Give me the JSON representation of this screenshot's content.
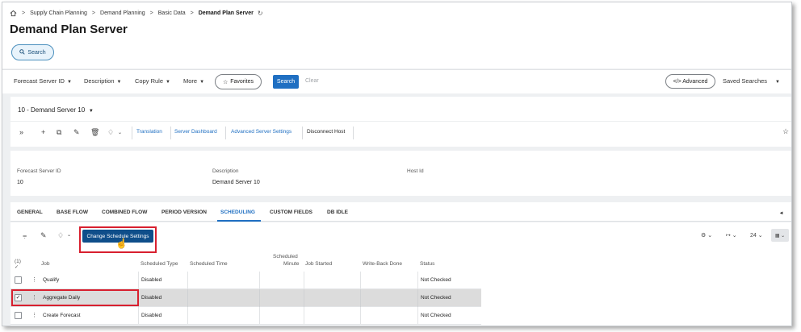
{
  "breadcrumb": {
    "items": [
      "Supply Chain Planning",
      "Demand Planning",
      "Basic Data"
    ],
    "current": "Demand Plan Server"
  },
  "page_title": "Demand Plan Server",
  "search_button": "Search",
  "filters": {
    "forecast_server_id": "Forecast Server ID",
    "description": "Description",
    "copy_rule": "Copy Rule",
    "more": "More",
    "favorites": "Favorites",
    "search": "Search",
    "clear": "Clear",
    "advanced": "</> Advanced",
    "saved_searches": "Saved Searches"
  },
  "server_selector": "10 - Demand Server 10",
  "toolbar": {
    "translation": "Translation",
    "server_dashboard": "Server Dashboard",
    "advanced_server_settings": "Advanced Server Settings",
    "disconnect_host": "Disconnect Host"
  },
  "info": {
    "forecast_server_id_label": "Forecast Server ID",
    "forecast_server_id_value": "10",
    "description_label": "Description",
    "description_value": "Demand Server 10",
    "host_id_label": "Host Id",
    "host_id_value": ""
  },
  "tabs": [
    "GENERAL",
    "BASE FLOW",
    "COMBINED FLOW",
    "PERIOD VERSION",
    "SCHEDULING",
    "CUSTOM FIELDS",
    "DB IDLE"
  ],
  "active_tab": "SCHEDULING",
  "grid": {
    "change_schedule_button": "Change Schedule Settings",
    "selected_count": "(1)",
    "page_size": "24",
    "columns": {
      "job": "Job",
      "scheduled_type": "Scheduled Type",
      "scheduled_time": "Scheduled Time",
      "scheduled_minute_line1": "Scheduled",
      "scheduled_minute_line2": "Minute",
      "job_started": "Job Started",
      "write_back_done": "Write-Back Done",
      "status": "Status"
    },
    "rows": [
      {
        "job": "Qualify",
        "scheduled_type": "Disabled",
        "status": "Not Checked",
        "selected": false
      },
      {
        "job": "Aggregate Daily",
        "scheduled_type": "Disabled",
        "status": "Not Checked",
        "selected": true
      },
      {
        "job": "Create Forecast",
        "scheduled_type": "Disabled",
        "status": "Not Checked",
        "selected": false
      }
    ]
  },
  "colors": {
    "primary": "#1f6fc2",
    "primary_dark": "#0f4e8a",
    "highlight_box": "#d8202f",
    "selected_row": "#dcdcdc"
  }
}
